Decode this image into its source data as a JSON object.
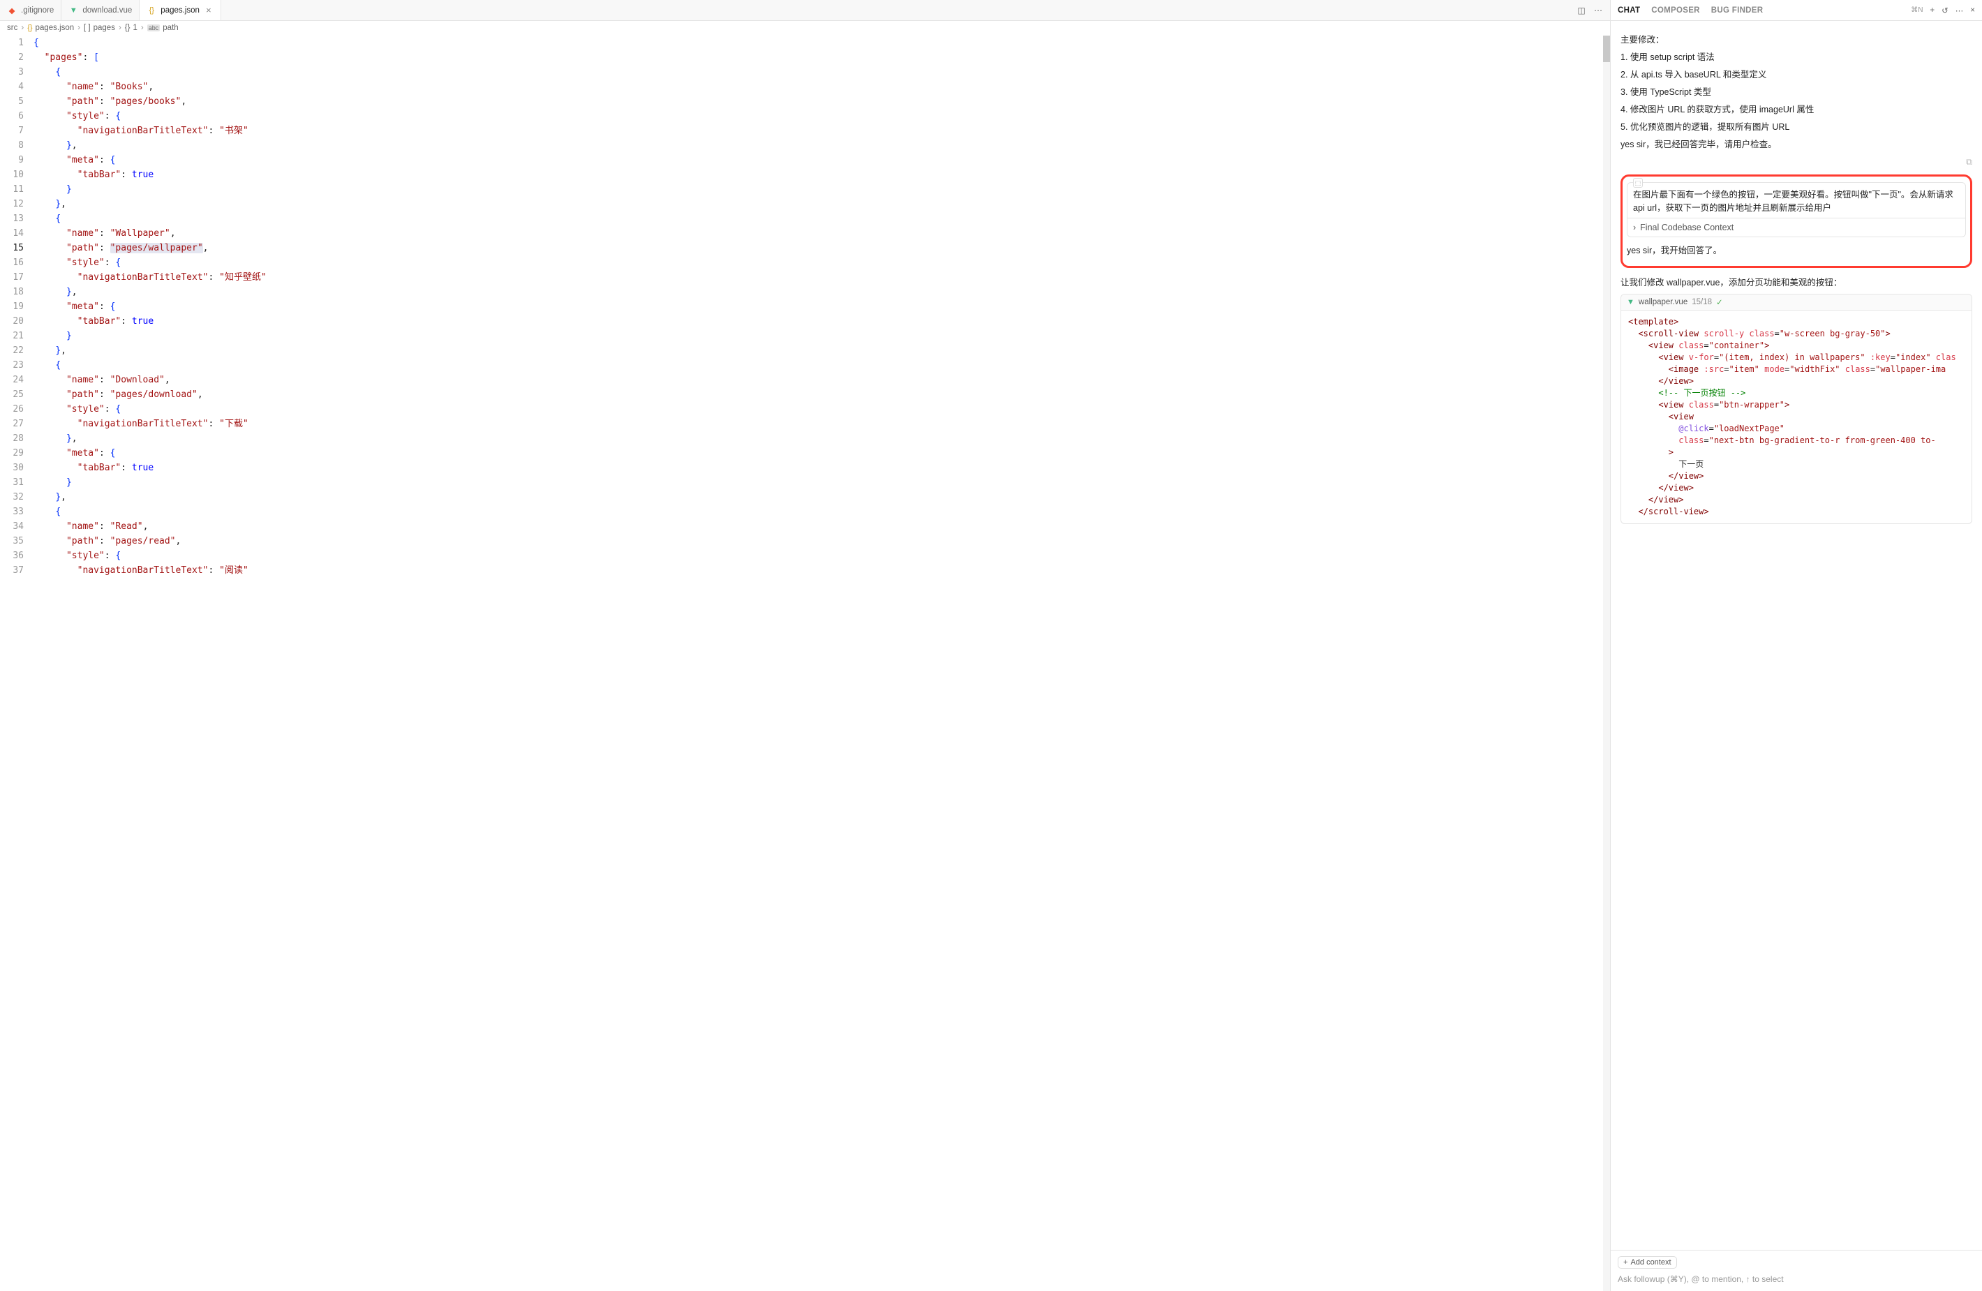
{
  "tabs": [
    {
      "label": ".gitignore",
      "icon": "git"
    },
    {
      "label": "download.vue",
      "icon": "vue"
    },
    {
      "label": "pages.json",
      "icon": "json",
      "active": true
    }
  ],
  "breadcrumb": [
    "src",
    "pages.json",
    "pages",
    "1",
    "path"
  ],
  "breadcrumb_icons": [
    "",
    "{}",
    "[ ]",
    "{}",
    "abc"
  ],
  "editor": {
    "current_line": 15,
    "lines": [
      "{",
      "  \"pages\": [",
      "    {",
      "      \"name\": \"Books\",",
      "      \"path\": \"pages/books\",",
      "      \"style\": {",
      "        \"navigationBarTitleText\": \"书架\"",
      "      },",
      "      \"meta\": {",
      "        \"tabBar\": true",
      "      }",
      "    },",
      "    {",
      "      \"name\": \"Wallpaper\",",
      "      \"path\": \"pages/wallpaper\",",
      "      \"style\": {",
      "        \"navigationBarTitleText\": \"知乎壁纸\"",
      "      },",
      "      \"meta\": {",
      "        \"tabBar\": true",
      "      }",
      "    },",
      "    {",
      "      \"name\": \"Download\",",
      "      \"path\": \"pages/download\",",
      "      \"style\": {",
      "        \"navigationBarTitleText\": \"下载\"",
      "      },",
      "      \"meta\": {",
      "        \"tabBar\": true",
      "      }",
      "    },",
      "    {",
      "      \"name\": \"Read\",",
      "      \"path\": \"pages/read\",",
      "      \"style\": {",
      "        \"navigationBarTitleText\": \"阅读\""
    ]
  },
  "chat": {
    "tabs": [
      "CHAT",
      "COMPOSER",
      "BUG FINDER"
    ],
    "active_tab": 0,
    "shortcut": "⌘N",
    "intro": "主要修改：",
    "changes": [
      "1. 使用 setup script 语法",
      "2. 从 api.ts 导入 baseURL 和类型定义",
      "3. 使用 TypeScript 类型",
      "4. 修改图片 URL 的获取方式，使用 imageUrl 属性",
      "5. 优化预览图片的逻辑，提取所有图片 URL"
    ],
    "done_msg": "yes sir，我已经回答完毕，请用户检查。",
    "user_msg": "在图片最下面有一个绿色的按钮，一定要美观好看。按钮叫做\"下一页\"。会从新请求api url，获取下一页的图片地址并且刷新展示给用户",
    "context_label": "Final Codebase Context",
    "ack_msg": "yes sir，我开始回答了。",
    "intro2": "让我们修改 wallpaper.vue，添加分页功能和美观的按钮：",
    "code_header": {
      "file": "wallpaper.vue",
      "diff": "15/18"
    },
    "code_lines": [
      {
        "t": "tag",
        "raw": "<template>"
      },
      {
        "t": "tag",
        "raw": "  <scroll-view scroll-y class=\"w-screen bg-gray-50\">"
      },
      {
        "t": "tag",
        "raw": "    <view class=\"container\">"
      },
      {
        "t": "tag",
        "raw": "      <view v-for=\"(item, index) in wallpapers\" :key=\"index\" clas"
      },
      {
        "t": "tag",
        "raw": "        <image :src=\"item\" mode=\"widthFix\" class=\"wallpaper-ima"
      },
      {
        "t": "tag",
        "raw": "      </view>"
      },
      {
        "t": "blank",
        "raw": ""
      },
      {
        "t": "comment",
        "raw": "      <!-- 下一页按钮 -->"
      },
      {
        "t": "tag",
        "raw": "      <view class=\"btn-wrapper\">"
      },
      {
        "t": "tag",
        "raw": "        <view"
      },
      {
        "t": "event",
        "raw": "          @click=\"loadNextPage\""
      },
      {
        "t": "tag",
        "raw": "          class=\"next-btn bg-gradient-to-r from-green-400 to-"
      },
      {
        "t": "tag",
        "raw": "        >"
      },
      {
        "t": "text",
        "raw": "          下一页"
      },
      {
        "t": "tag",
        "raw": "        </view>"
      },
      {
        "t": "tag",
        "raw": "      </view>"
      },
      {
        "t": "tag",
        "raw": "    </view>"
      },
      {
        "t": "tag",
        "raw": "  </scroll-view>"
      }
    ],
    "add_context": "Add context",
    "followup_placeholder": "Ask followup (⌘Y), @ to mention, ↑ to select"
  }
}
